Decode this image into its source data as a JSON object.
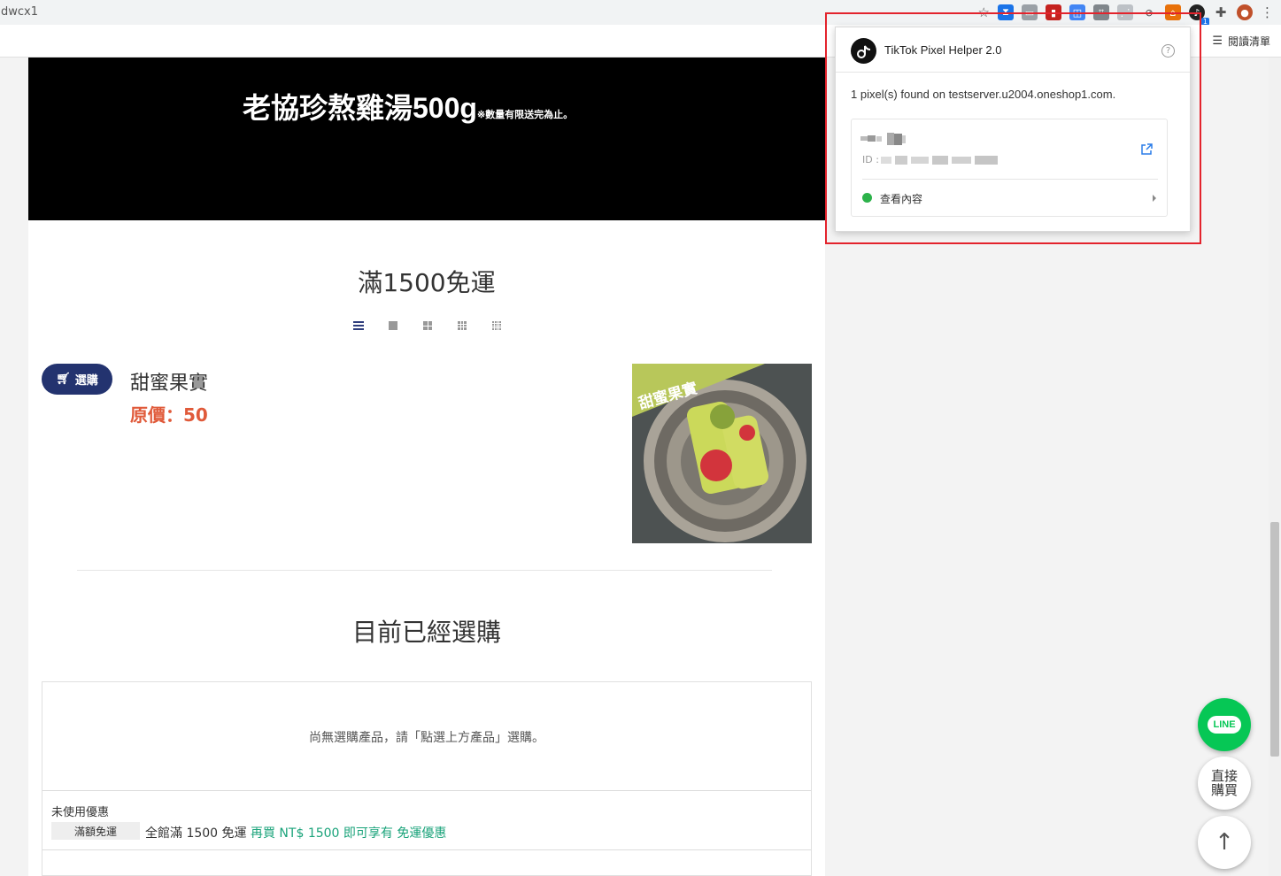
{
  "browser": {
    "tab_title": "dwcx1",
    "reading_list_label": "閱讀清單",
    "extension_badge": "1"
  },
  "banner": {
    "title": "老協珍熬雞湯500g",
    "note": "※數量有限送完為止。"
  },
  "section": {
    "title": "滿1500免運"
  },
  "product": {
    "buy_label": "選購",
    "name": "甜蜜果實",
    "price_label": "原價：50",
    "image_caption": "甜蜜果實"
  },
  "cart": {
    "title": "目前已經選購",
    "empty_text": "尚無選購產品，請「點選上方產品」選購。",
    "coupon_heading": "未使用優惠",
    "coupon_tag": "滿額免運",
    "coupon_desc": "全館滿 1500 免運",
    "coupon_highlight": "再買 NT$ 1500 即可享有 免運優惠"
  },
  "floating": {
    "line_label": "LINE",
    "buy_now_line1": "直接",
    "buy_now_line2": "購買",
    "scroll_top_icon": "↑"
  },
  "popup": {
    "title": "TikTok Pixel Helper 2.0",
    "help_icon": "?",
    "found_text": "1 pixel(s) found on testserver.u2004.oneshop1.com.",
    "id_label": "ID :",
    "event_label": "查看內容"
  },
  "colors": {
    "banner_bg": "#000000",
    "buy_button": "#23336f",
    "price": "#e05a3a",
    "coupon_highlight": "#1aa37a",
    "line_green": "#06c755",
    "highlight_box": "#e3232c"
  }
}
